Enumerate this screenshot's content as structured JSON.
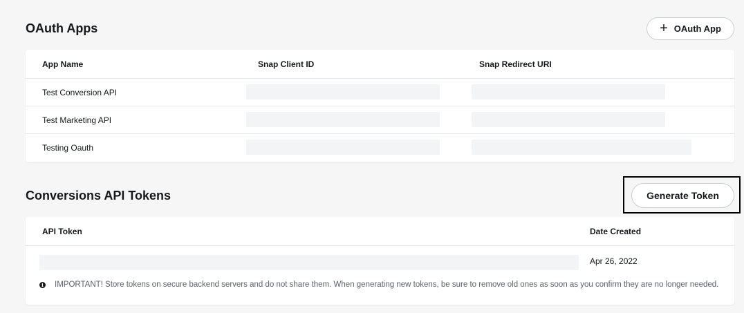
{
  "oauth": {
    "title": "OAuth Apps",
    "add_button": {
      "icon": "plus-icon",
      "label": "OAuth App"
    },
    "columns": [
      "App Name",
      "Snap Client ID",
      "Snap Redirect URI"
    ],
    "rows": [
      {
        "app_name": "Test Conversion API"
      },
      {
        "app_name": "Test Marketing API"
      },
      {
        "app_name": "Testing Oauth"
      }
    ]
  },
  "tokens": {
    "title": "Conversions API Tokens",
    "generate_button_label": "Generate Token",
    "columns": [
      "API Token",
      "Date Created"
    ],
    "rows": [
      {
        "date_created": "Apr 26, 2022"
      }
    ],
    "notice": {
      "icon": "info-icon",
      "text": "IMPORTANT! Store tokens on secure backend servers and do not share them. When generating new tokens, be sure to remove old ones as soon as you confirm they are no longer needed."
    }
  },
  "colors": {
    "page_background": "#f6f6f7",
    "card_background": "#ffffff",
    "placeholder": "#f3f4f5",
    "text_primary": "#16191c",
    "text_secondary": "#5a6169",
    "highlight_border": "#000000"
  }
}
